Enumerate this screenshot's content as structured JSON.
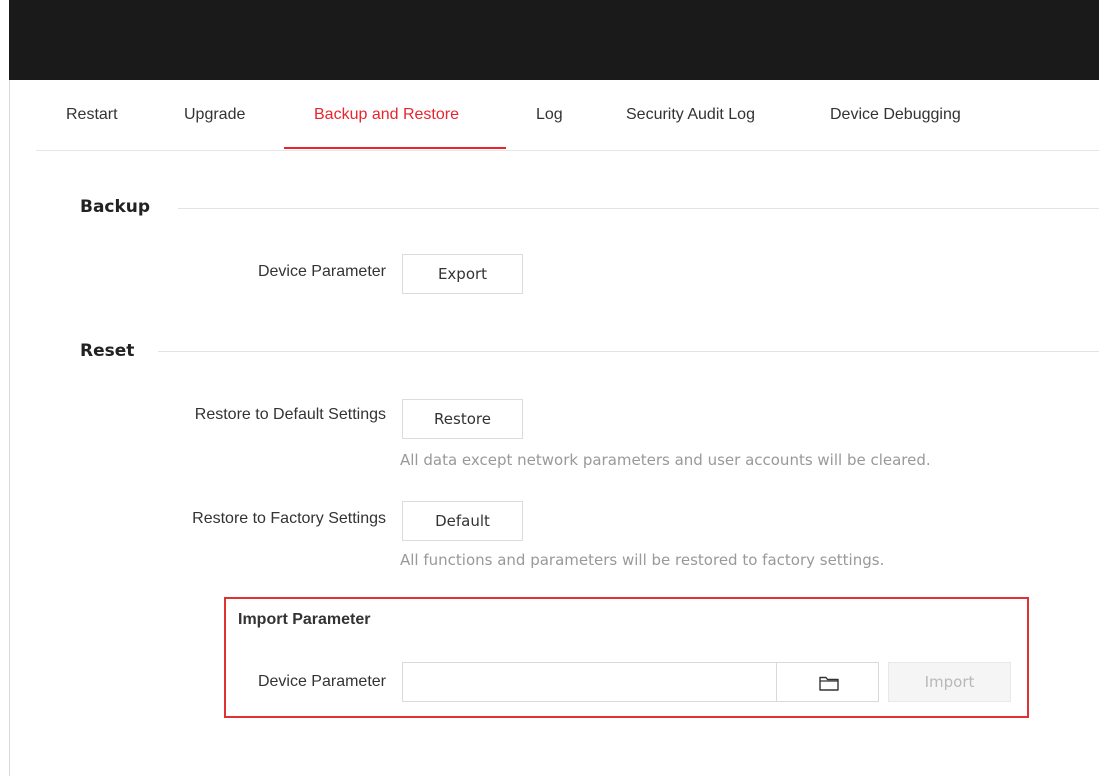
{
  "tabs": [
    {
      "label": "Restart",
      "active": false
    },
    {
      "label": "Upgrade",
      "active": false
    },
    {
      "label": "Backup and Restore",
      "active": true
    },
    {
      "label": "Log",
      "active": false
    },
    {
      "label": "Security Audit Log",
      "active": false
    },
    {
      "label": "Device Debugging",
      "active": false
    }
  ],
  "backup": {
    "title": "Backup",
    "device_parameter_label": "Device Parameter",
    "export_label": "Export"
  },
  "reset": {
    "title": "Reset",
    "restore_default_label": "Restore to Default Settings",
    "restore_button": "Restore",
    "restore_hint": "All data except network parameters and user accounts will be cleared.",
    "restore_factory_label": "Restore to Factory Settings",
    "default_button": "Default",
    "default_hint": "All functions and parameters will be restored to factory settings."
  },
  "import": {
    "title": "Import Parameter",
    "device_parameter_label": "Device Parameter",
    "file_value": "",
    "browse_icon": "folder-icon",
    "import_button": "Import"
  },
  "colors": {
    "accent": "#e7252f",
    "highlight_border": "#e03232",
    "topbar": "#1a1a1a"
  }
}
